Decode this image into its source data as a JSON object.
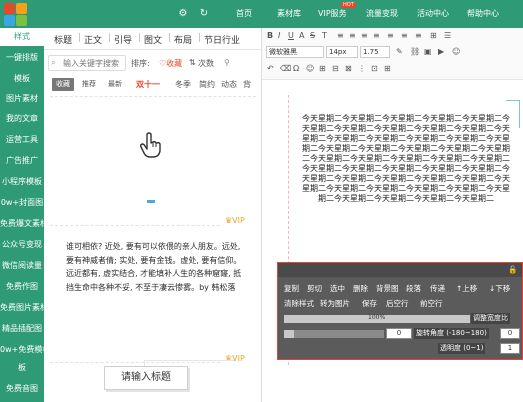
{
  "nav": {
    "links": [
      "首页",
      "素材库",
      "VIP服务",
      "流量变现",
      "活动中心",
      "帮助中心"
    ],
    "badge": "HOT",
    "icons": [
      "gear-icon",
      "refresh-icon"
    ],
    "brand_colors": [
      "#e8482a",
      "#f3a11b",
      "#3aa6e3",
      "#7bc043"
    ]
  },
  "sidebar": {
    "items": [
      "样式",
      "一键排版",
      "模板",
      "图片素材",
      "我的文章",
      "运营工具",
      "广告推广",
      "小程序模板",
      "0w+封面图",
      "免费爆文素材",
      "公众号变现",
      "微信阅读量",
      "免费作图",
      "免费图片素材",
      "精品插配图",
      "0w+免费模板",
      "板",
      "免费音图"
    ],
    "active_index": 0
  },
  "panel": {
    "tabs": [
      "标题",
      "正文",
      "引导",
      "图文",
      "布局",
      "节日行业"
    ],
    "search_placeholder": "输入关键字搜索",
    "sort_label": "排序:",
    "fav_label": "♡收藏",
    "count_label": "次数",
    "chips": [
      "收藏",
      "推荐",
      "最新"
    ],
    "tags": [
      "双十一",
      "冬季",
      "简约",
      "动态",
      "背"
    ],
    "vip_label": "VIP",
    "quote_text": "谁可相依? 近处, 要有可以依偎的亲人朋友。远处, 要有神威者倩; 实处, 要有金钱。虚处, 要有信仰。远近都有, 虚实结合, 才能填补人生的各种窟窿, 抵挡生命中各种不妥, 不至于凄云惨雾。by 韩松落",
    "title_button": "请输入标题"
  },
  "toolbar": {
    "row1": [
      "B",
      "I",
      "U",
      "A",
      "S",
      "T",
      "≡",
      "≡",
      "≡",
      "≡",
      "≡",
      "≡",
      "≡",
      "⊞",
      "☰"
    ],
    "font_family": "微软雅黑",
    "font_size": "14px",
    "line_height": "1.75",
    "row3": [
      "↶",
      "⌫",
      "Ω",
      "☺",
      "⊞",
      "⊟",
      "⊠",
      "⋮",
      "⊡",
      "⊞"
    ]
  },
  "doc": {
    "text": "今天星期二今天星期二今天星期二今天星期二今天星期二今天星期二今天星期二今天星期二今天星期二今天星期二今天星期二今天星期二今天星期二今天星期二今天星期二今天星期二今天星期二今天星期二今天星期二今天星期二今天星期二今天星期二今天星期二今天星期二今天星期二今天星期二今天星期二今天星期二今天星期二今天星期二今天星期二今天星期二今天星期二今天星期二今天星期二今天星期二今天星期二今天星期二今天星期二今天星期二今天星期二今天星期二今天星期二今天星期二今天星期二今天星期二"
  },
  "context": {
    "row1": [
      "复制",
      "剪切",
      "选中",
      "删除",
      "背景图",
      "段落",
      "传递",
      "↑上移",
      "↓下移"
    ],
    "row2": [
      "清除样式",
      "转为图片",
      "保存",
      "后空行",
      "前空行"
    ],
    "opacity_pct": "100%",
    "adjust_label": "调整宽度比",
    "value_a": "0",
    "rotate_label": "旋转角度 (-180~180)",
    "value_b": "0",
    "transparency_label": "透明度 (0~1)",
    "value_c": "1",
    "lock_icon": "unlock-icon"
  }
}
